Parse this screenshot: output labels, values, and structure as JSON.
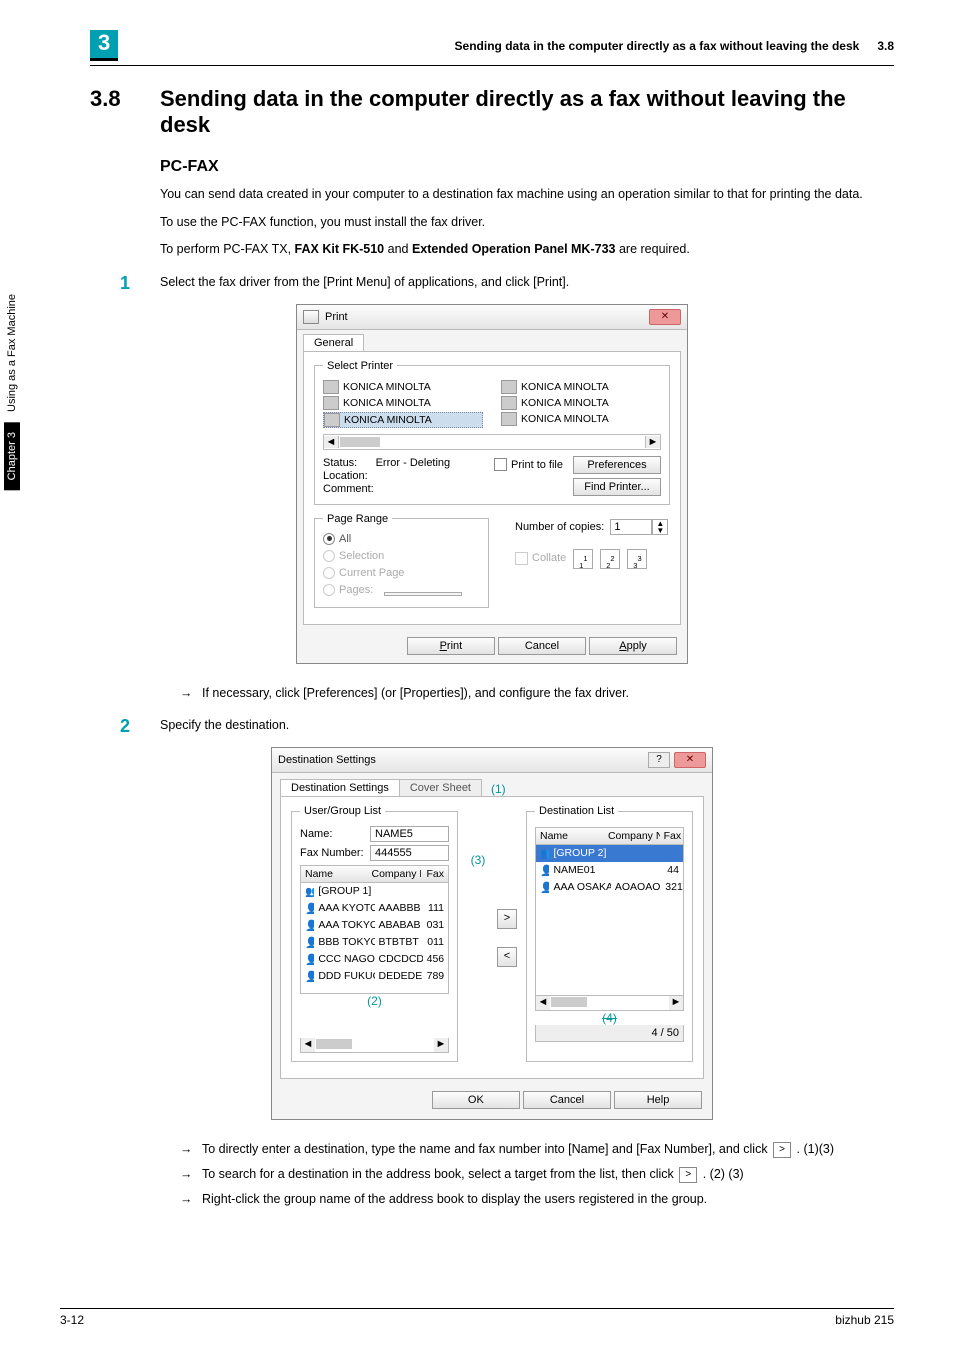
{
  "sidebar": {
    "chapter": "Chapter 3",
    "label": "Using as a Fax Machine"
  },
  "header": {
    "badge": "3",
    "title": "Sending data in the computer directly as a fax without leaving the desk",
    "secno": "3.8"
  },
  "section": {
    "num": "3.8",
    "title": "Sending data in the computer directly as a fax without leaving the desk"
  },
  "sub": {
    "pcfax": "PC-FAX"
  },
  "para": {
    "p1": "You can send data created in your computer to a destination fax machine using an operation similar to that for printing the data.",
    "p2": "To use the PC-FAX function, you must install the fax driver.",
    "p3a": "To perform PC-FAX TX, ",
    "p3b": "FAX Kit FK-510",
    "p3c": " and ",
    "p3d": "Extended Operation Panel MK-733",
    "p3e": " are required."
  },
  "steps": {
    "s1": "Select the fax driver from the [Print Menu] of applications, and click [Print].",
    "s2": "Specify the destination."
  },
  "notes": {
    "n1": "If necessary, click [Preferences] (or [Properties]), and configure the fax driver.",
    "n2a": "To directly enter a destination, type the name and fax number into [Name] and [Fax Number], and click ",
    "n2b": " . (1)(3)",
    "n3a": "To search for a destination in the address book, select a target from the list, then click ",
    "n3b": " . (2) (3)",
    "n4": "Right-click the group name of the address book to display the users registered in the group."
  },
  "print_dialog": {
    "title": "Print",
    "tab": "General",
    "grp_select": "Select Printer",
    "printers_left": [
      "KONICA MINOLTA",
      "KONICA MINOLTA",
      "KONICA MINOLTA"
    ],
    "printers_right": [
      "KONICA MINOLTA",
      "KONICA MINOLTA",
      "KONICA MINOLTA"
    ],
    "status_lbl": "Status:",
    "status_val": "Error - Deleting",
    "location_lbl": "Location:",
    "comment_lbl": "Comment:",
    "print_to_file": "Print to file",
    "btn_pref": "Preferences",
    "btn_find": "Find Printer...",
    "grp_range": "Page Range",
    "opt_all": "All",
    "opt_sel": "Selection",
    "opt_cur": "Current Page",
    "opt_pages": "Pages:",
    "copies_lbl": "Number of copies:",
    "copies_val": "1",
    "collate": "Collate",
    "c1": "1",
    "c2": "2",
    "c3": "3",
    "btn_print": "Print",
    "btn_cancel": "Cancel",
    "btn_apply": "Apply"
  },
  "dest_dialog": {
    "title": "Destination Settings",
    "tab1": "Destination Settings",
    "tab2": "Cover Sheet",
    "annot1": "(1)",
    "annot2": "(2)",
    "annot3": "(3)",
    "annot4": "(4)",
    "grp_left": "User/Group List",
    "grp_right": "Destination List",
    "lbl_name": "Name:",
    "val_name": "NAME5",
    "lbl_fax": "Fax Number:",
    "val_fax": "444555",
    "head_name": "Name",
    "head_comp": "Company Name",
    "head_fax": "Fax",
    "left_rows": [
      {
        "name": "[GROUP 1]",
        "comp": "",
        "fax": ""
      },
      {
        "name": "AAA KYOTO",
        "comp": "AAABBB",
        "fax": "111"
      },
      {
        "name": "AAA TOKYO",
        "comp": "ABABAB",
        "fax": "031"
      },
      {
        "name": "BBB TOKYO",
        "comp": "BTBTBT",
        "fax": "011"
      },
      {
        "name": "CCC NAGOYA",
        "comp": "CDCDCD",
        "fax": "456"
      },
      {
        "name": "DDD FUKUOKA",
        "comp": "DEDEDE",
        "fax": "789"
      }
    ],
    "right_rows": [
      {
        "name": "[GROUP 2]",
        "comp": "",
        "fax": "",
        "sel": true
      },
      {
        "name": "NAME01",
        "comp": "",
        "fax": "44"
      },
      {
        "name": "AAA OSAKA",
        "comp": "AOAOAO",
        "fax": "321"
      }
    ],
    "btn_add": ">",
    "btn_remove": "<",
    "count": "4 / 50",
    "btn_ok": "OK",
    "btn_cancel": "Cancel",
    "btn_help": "Help"
  },
  "footer": {
    "left": "3-12",
    "right": "bizhub 215"
  }
}
